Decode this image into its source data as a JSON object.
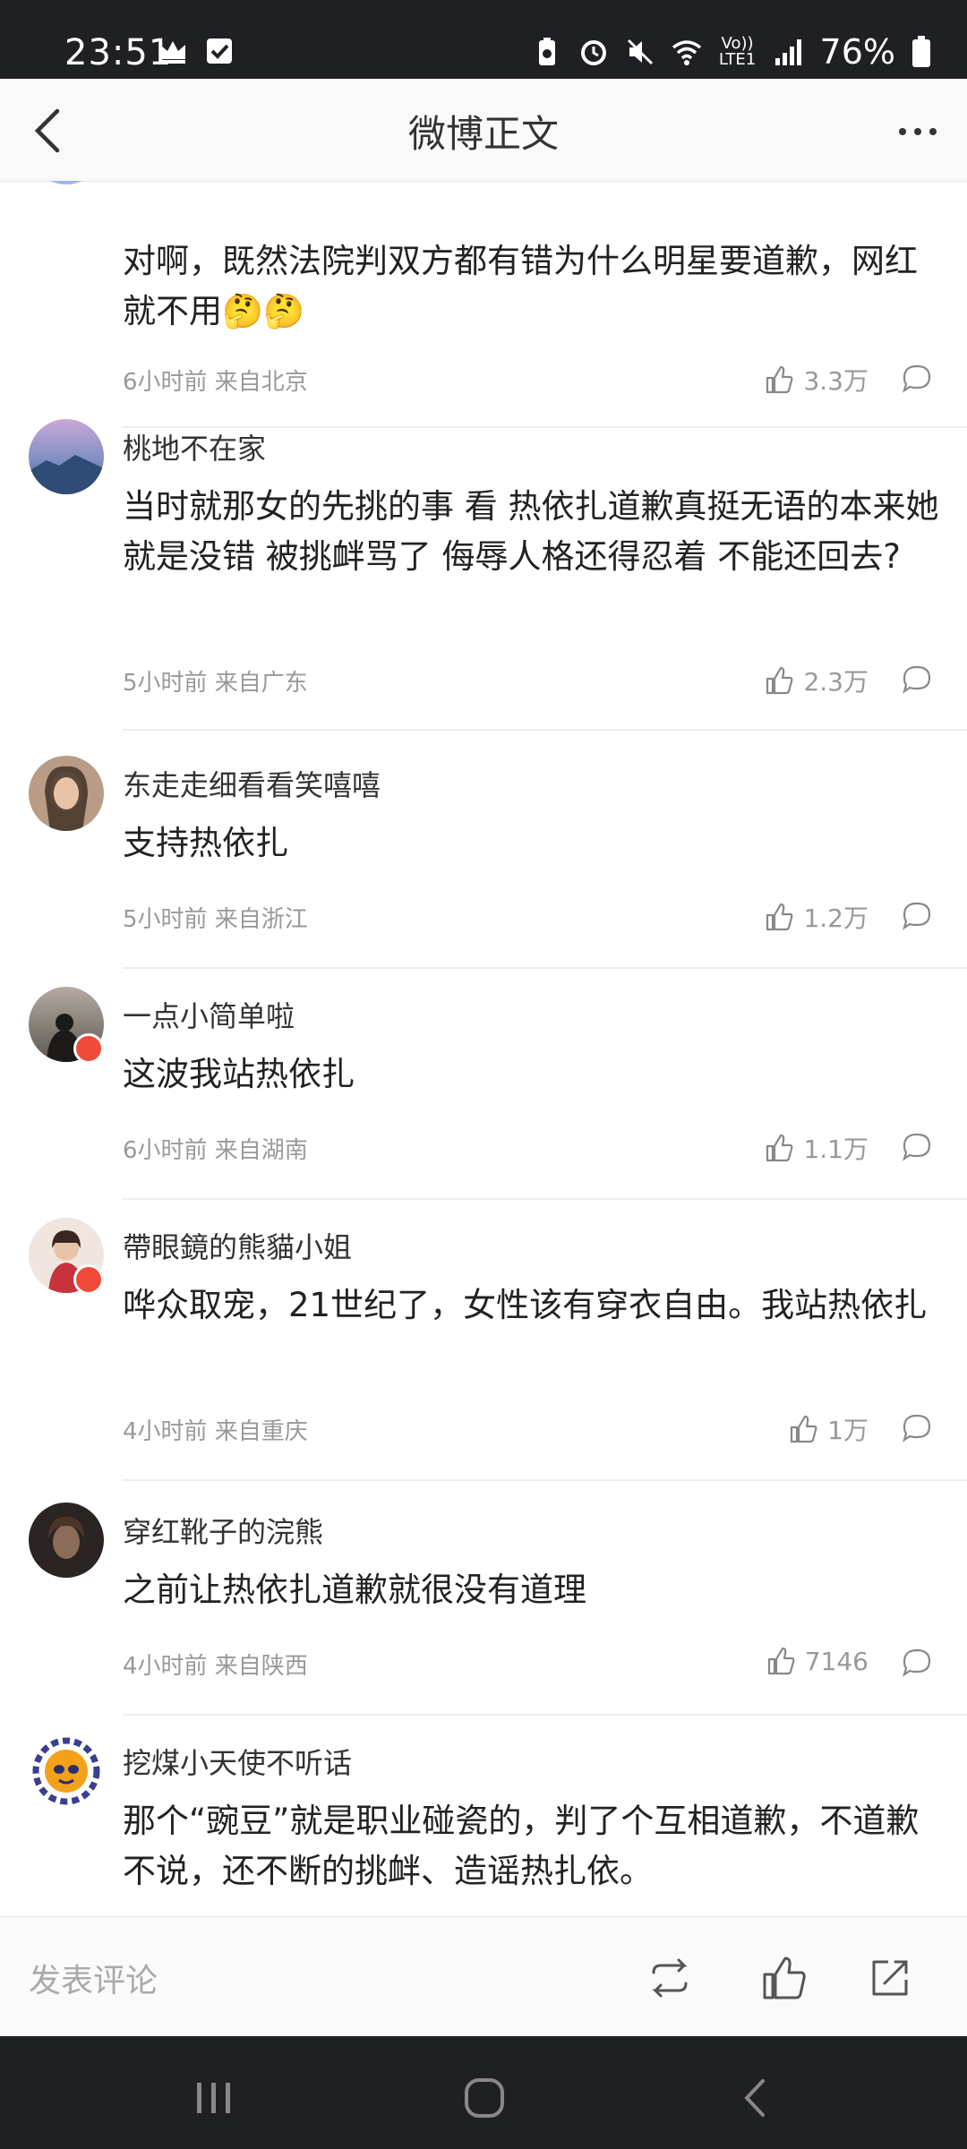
{
  "status_bar": {
    "time": "23:51",
    "volte_label": "Vo)) LTE1",
    "battery": "76%",
    "icons": [
      "crown-icon",
      "checkbox-icon",
      "battery-saver-icon",
      "alarm-icon",
      "mute-icon",
      "wifi-icon",
      "signal-icon",
      "battery-icon"
    ]
  },
  "nav": {
    "title": "微博正文",
    "back_icon": "chevron-left-icon",
    "more_icon": "more-dots-icon"
  },
  "comments": [
    {
      "text": "对啊，既然法院判双方都有错为什么明星要道歉，网红就不用🤔🤔",
      "meta": "6小时前  来自北京",
      "likes": "3.3万"
    },
    {
      "name": "桃地不在家",
      "text": "当时就那女的先挑的事 看 热依扎道歉真挺无语的本来她就是没错 被挑衅骂了 侮辱人格还得忍着 不能还回去?",
      "meta": "5小时前  来自广东",
      "likes": "2.3万"
    },
    {
      "name": "东走走细看看笑嘻嘻",
      "text": "支持热依扎",
      "meta": "5小时前  来自浙江",
      "likes": "1.2万"
    },
    {
      "name": "一点小简单啦",
      "text": "这波我站热依扎",
      "meta": "6小时前  来自湖南",
      "likes": "1.1万"
    },
    {
      "name": "帶眼鏡的熊貓小姐",
      "text": "哗众取宠，21世纪了，女性该有穿衣自由。我站热依扎",
      "meta": "4小时前  来自重庆",
      "likes": "1万"
    },
    {
      "name": "穿红靴子的浣熊",
      "text": "之前让热依扎道歉就很没有道理",
      "meta": "4小时前  来自陕西",
      "likes": "7146"
    },
    {
      "name": "挖煤小天使不听话",
      "text": "那个“豌豆”就是职业碰瓷的，判了个互相道歉，不道歉不说，还不断的挑衅、造谣热扎依。"
    }
  ],
  "bottom_bar": {
    "placeholder": "发表评论",
    "icons": [
      "repost-icon",
      "like-icon",
      "share-icon"
    ]
  },
  "system_nav": {
    "icons": [
      "recents-icon",
      "home-icon",
      "back-icon"
    ]
  },
  "colors": {
    "status_bg": "#1f2023",
    "meta_text": "#999999",
    "divider": "#eeeeee",
    "badge_red": "#f04a3a"
  }
}
